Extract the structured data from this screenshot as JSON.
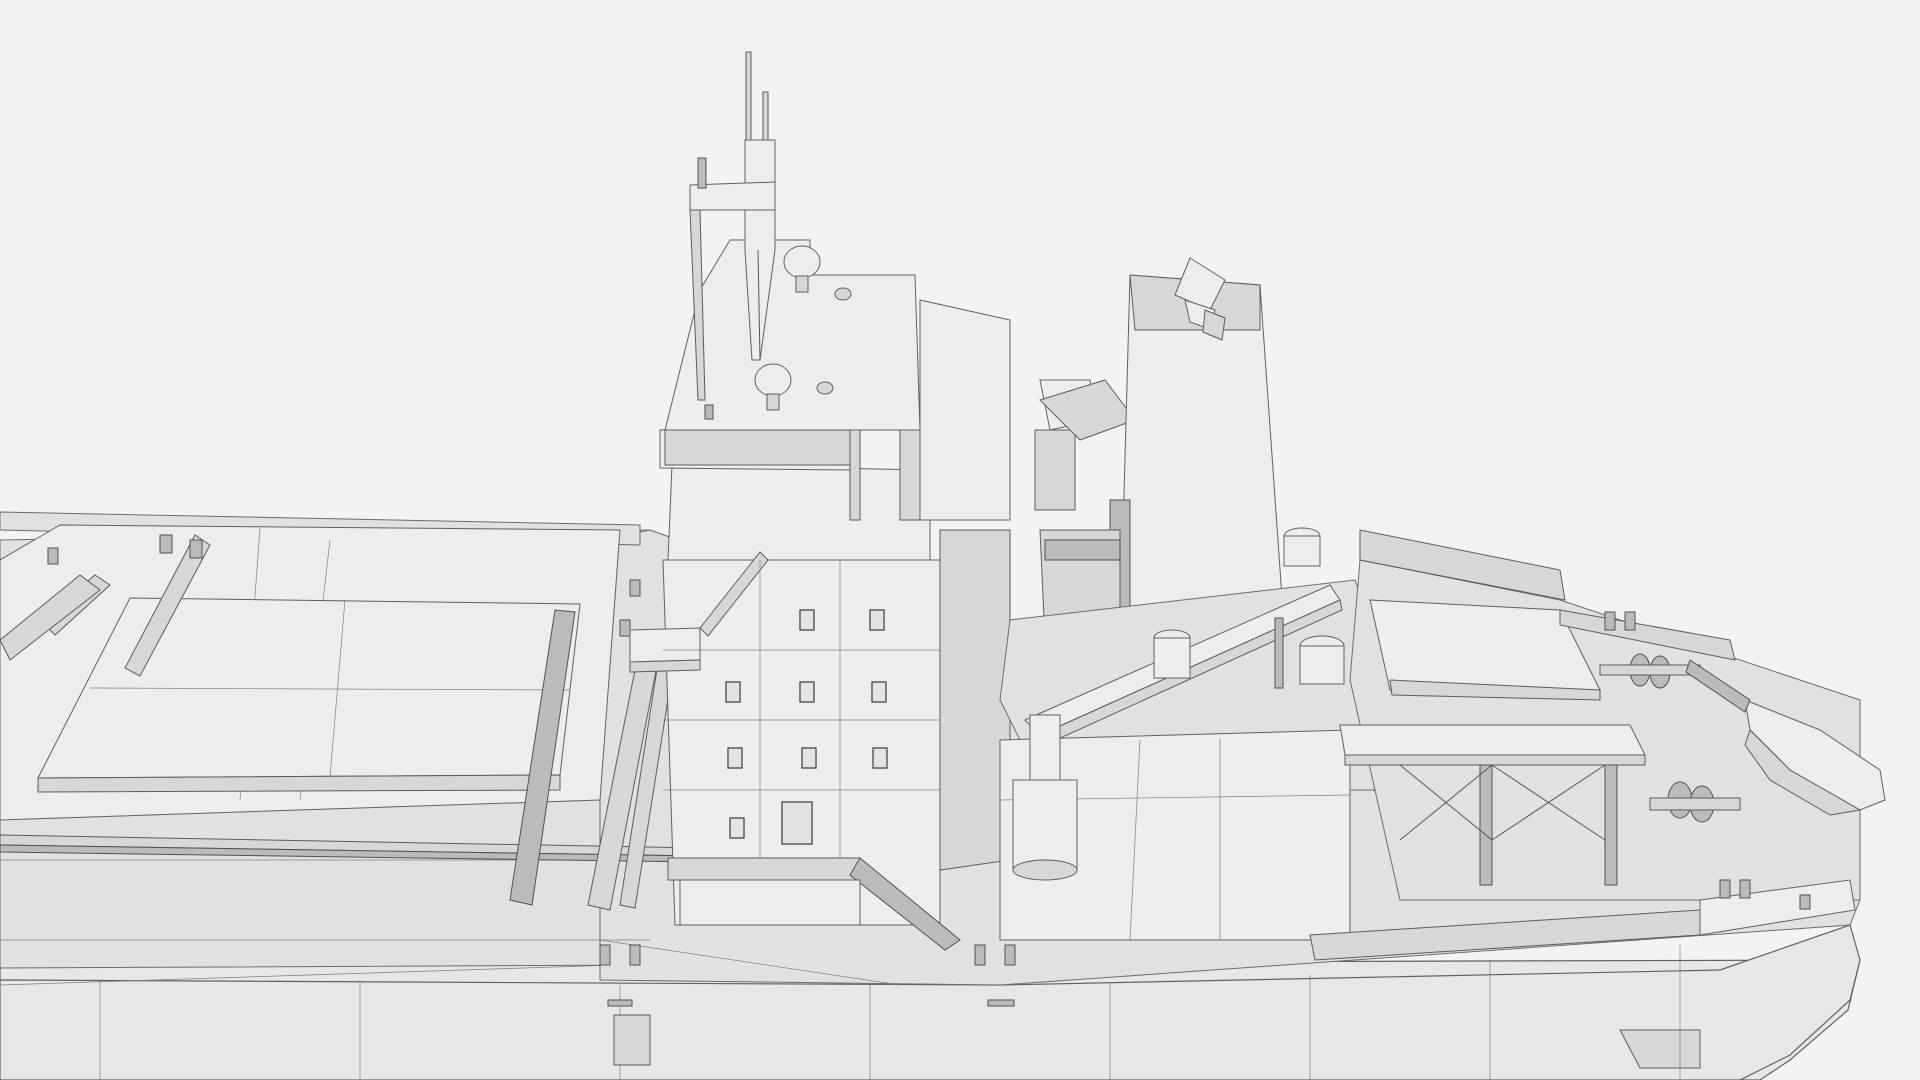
{
  "scene": {
    "subject": "ship-3d-model-wireframe",
    "background_color": "#f3f3f3",
    "hull_color": "#e6e8e5",
    "wire_color": "#5f625f"
  }
}
